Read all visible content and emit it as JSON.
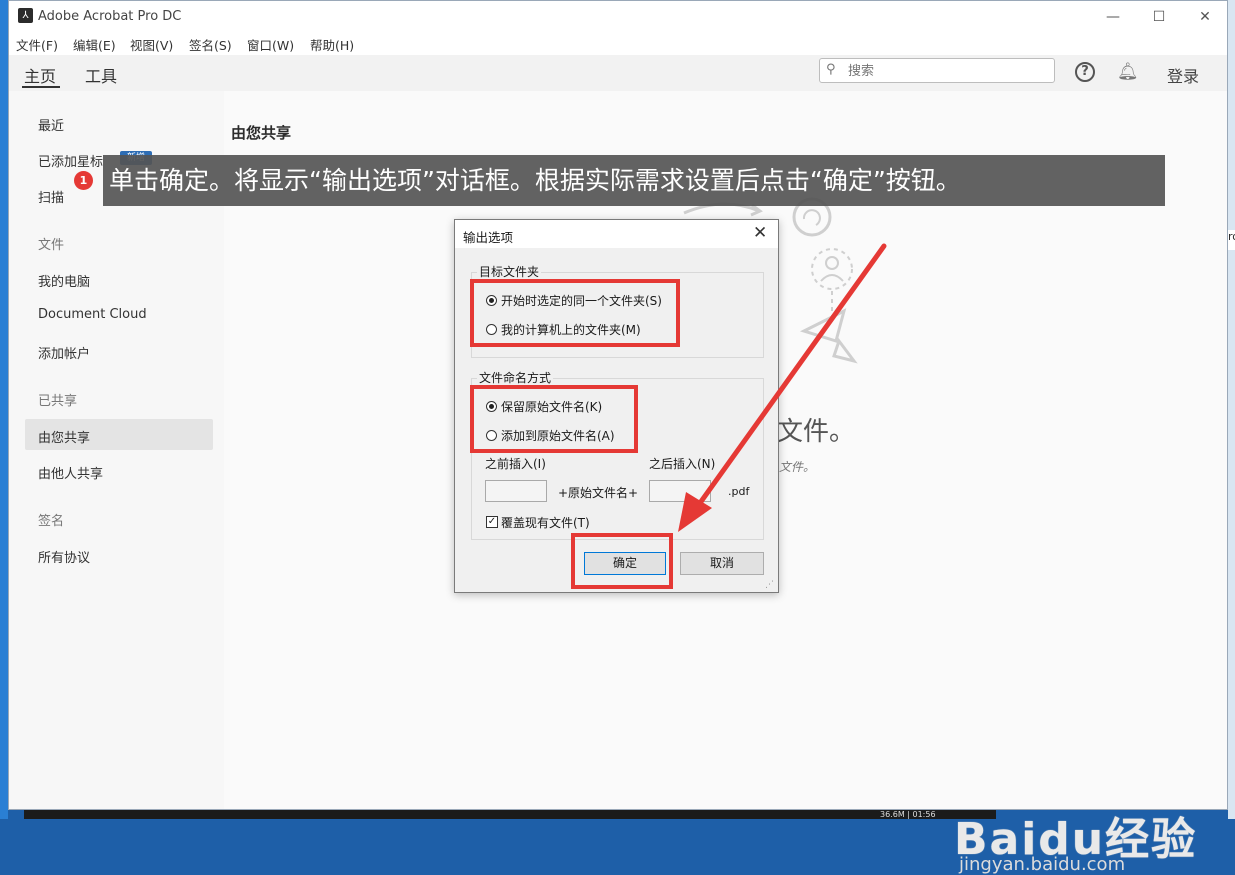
{
  "window": {
    "title": "Adobe Acrobat Pro DC",
    "controls": {
      "minimize": "—",
      "maximize": "☐",
      "close": "✕"
    }
  },
  "menubar": [
    "文件(F)",
    "编辑(E)",
    "视图(V)",
    "签名(S)",
    "窗口(W)",
    "帮助(H)"
  ],
  "tabs": [
    {
      "label": "主页",
      "active": true
    },
    {
      "label": "工具",
      "active": false
    }
  ],
  "search": {
    "placeholder": "搜索"
  },
  "header": {
    "login": "登录"
  },
  "sidebar": {
    "items": [
      {
        "label": "最近",
        "type": "item"
      },
      {
        "label": "已添加星标",
        "type": "item",
        "badge": "新增"
      },
      {
        "label": "扫描",
        "type": "item"
      },
      {
        "label": "文件",
        "type": "section"
      },
      {
        "label": "我的电脑",
        "type": "item"
      },
      {
        "label": "Document Cloud",
        "type": "item"
      },
      {
        "label": "添加帐户",
        "type": "item"
      },
      {
        "label": "已共享",
        "type": "section"
      },
      {
        "label": "由您共享",
        "type": "item",
        "selected": true
      },
      {
        "label": "由他人共享",
        "type": "item"
      },
      {
        "label": "签名",
        "type": "section"
      },
      {
        "label": "所有协议",
        "type": "item"
      }
    ]
  },
  "main": {
    "title": "由您共享",
    "empty_text": "文件。",
    "empty_sub": "文件。"
  },
  "annotation": {
    "number": "1",
    "text": "单击确定。将显示“输出选项”对话框。根据实际需求设置后点击“确定”按钮。"
  },
  "dialog": {
    "title": "输出选项",
    "target_folder": {
      "title": "目标文件夹",
      "options": [
        {
          "label": "开始时选定的同一个文件夹(S)",
          "checked": true
        },
        {
          "label": "我的计算机上的文件夹(M)",
          "checked": false
        }
      ]
    },
    "naming": {
      "title": "文件命名方式",
      "options": [
        {
          "label": "保留原始文件名(K)",
          "checked": true
        },
        {
          "label": "添加到原始文件名(A)",
          "checked": false
        }
      ],
      "insert_before_label": "之前插入(I)",
      "insert_after_label": "之后插入(N)",
      "insert_before_value": "",
      "insert_after_value": "",
      "middle_text": "+原始文件名+",
      "extension": ".pdf",
      "overwrite_label": "覆盖现有文件(T)",
      "overwrite_checked": true
    },
    "ok_label": "确定",
    "cancel_label": "取消"
  },
  "watermark": {
    "logo": "Baidu经验",
    "url": "jingyan.baidu.com"
  },
  "taskbar": {
    "status": "36.6M | 01:56"
  },
  "colors": {
    "accent_red": "#e53935",
    "badge_blue": "#2d6db5",
    "annotation_bg": "#555555"
  }
}
